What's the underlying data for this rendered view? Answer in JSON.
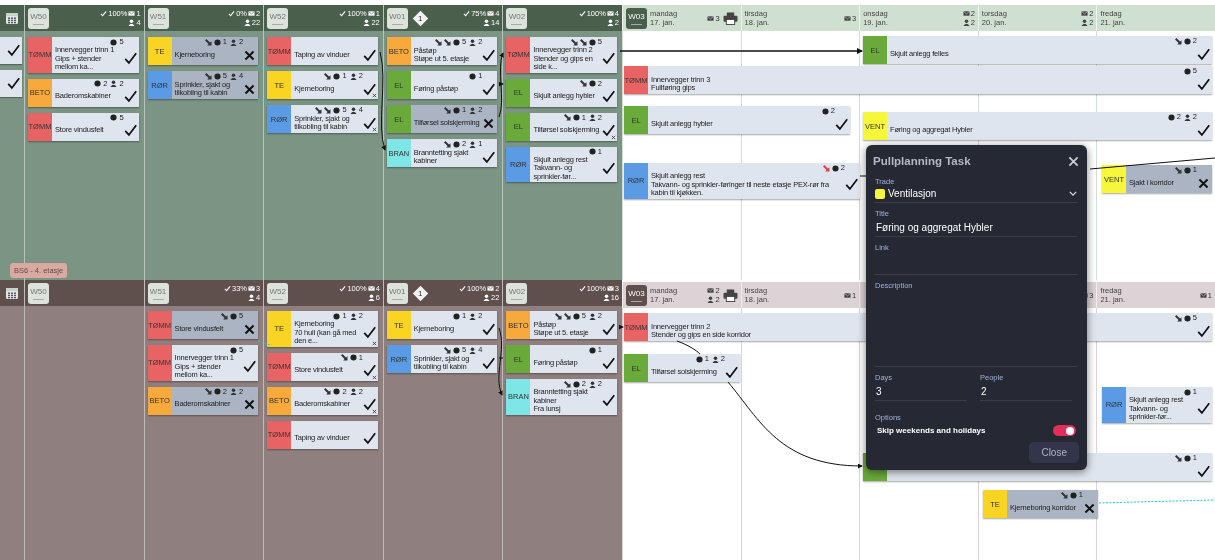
{
  "lanes": [
    {
      "label": "BS6 - 4. etasje",
      "cut_tasks": [
        {
          "blocked": false
        },
        {
          "blocked": false
        }
      ],
      "weeks": [
        {
          "week": "W50",
          "done": "100%",
          "messages": "1",
          "people": "4",
          "tasks": [
            {
              "trade": "TØMM",
              "color": "#e86464",
              "title": "Innervegger trinn 1",
              "subtitle": "Gips + stender mellom ka...",
              "comments": "5",
              "blocked": false,
              "flagged": false
            },
            {
              "trade": "BETO",
              "color": "#f7a93b",
              "title": "Baderomskabiner",
              "comments": "2",
              "people": "2",
              "blocked": false,
              "flagged": false
            },
            {
              "trade": "TØMM",
              "color": "#e86464",
              "title": "Store vindusfelt",
              "comments": "5",
              "blocked": false,
              "flagged": false
            }
          ]
        },
        {
          "week": "W51",
          "done": "0%",
          "messages": "2",
          "people": "22",
          "tasks": [
            {
              "trade": "TE",
              "color": "#f9d423",
              "title": "Kjerneboring",
              "links": [
                {
                  "color": "#333333"
                }
              ],
              "comments": "1",
              "people": "2",
              "blocked": true,
              "flagged": false
            },
            {
              "trade": "RØR",
              "color": "#5b9be6",
              "title": "Sprinkler, sjakt og tilkobling til kabin",
              "links": [
                {
                  "color": "#333333"
                }
              ],
              "comments": "5",
              "people": "4",
              "blocked": true,
              "flagged": false
            }
          ]
        },
        {
          "week": "W52",
          "done": "100%",
          "messages": "1",
          "people": "22",
          "tasks": [
            {
              "trade": "TØMM",
              "color": "#e86464",
              "title": "Taping av vinduer",
              "blocked": false,
              "flagged": false
            },
            {
              "trade": "TE",
              "color": "#f9d423",
              "title": "Kjerneboring",
              "links": [
                {
                  "color": "#333333"
                }
              ],
              "comments": "1",
              "people": "2",
              "blocked": false,
              "flagged": true
            },
            {
              "trade": "RØR",
              "color": "#5b9be6",
              "title": "Sprinkler, sjakt og tilkobling til kabin",
              "links": [
                {
                  "color": "#333333"
                },
                {
                  "color": "#333333"
                }
              ],
              "comments": "5",
              "people": "4",
              "blocked": false,
              "flagged": true
            }
          ]
        },
        {
          "week": "W01",
          "milestone": "1",
          "done": "75%",
          "messages": "4",
          "people": "14",
          "tasks": [
            {
              "trade": "BETO",
              "color": "#f7a93b",
              "title": "Påstøp",
              "subtitle": "Støpe ut 5. etasje",
              "links": [
                {
                  "color": "#333333"
                },
                {
                  "color": "#333333"
                }
              ],
              "comments": "5",
              "people": "2",
              "blocked": false,
              "flagged": false
            },
            {
              "trade": "EL",
              "color": "#6aaa3a",
              "title": "Føring påstøp",
              "comments": "1",
              "blocked": false,
              "flagged": false
            },
            {
              "trade": "EL",
              "color": "#6aaa3a",
              "title": "Tilførsel solskjerming",
              "links": [
                {
                  "color": "#333333"
                }
              ],
              "comments": "1",
              "people": "2",
              "blocked": true,
              "flagged": false
            },
            {
              "trade": "BRAN",
              "color": "#7ee6e6",
              "title": "Branntetting sjakt kabiner",
              "links": [
                {
                  "color": "#333333"
                }
              ],
              "comments": "2",
              "people": "1",
              "blocked": false,
              "flagged": false
            }
          ]
        },
        {
          "week": "W02",
          "done": "100%",
          "messages": "4",
          "people": "2",
          "tasks": [
            {
              "trade": "TØMM",
              "color": "#e86464",
              "title": "Innervegger trinn 2",
              "subtitle": "Stender og gips en side k...",
              "links": [
                {
                  "color": "#333333"
                },
                {
                  "color": "#333333"
                }
              ],
              "comments": "5",
              "blocked": false,
              "flagged": false
            },
            {
              "trade": "EL",
              "color": "#6aaa3a",
              "title": "Skjult anlegg hybler",
              "links": [
                {
                  "color": "#333333"
                }
              ],
              "comments": "2",
              "blocked": false,
              "flagged": false
            },
            {
              "trade": "EL",
              "color": "#6aaa3a",
              "title": "Tilførsel solskjerming",
              "links": [
                {
                  "color": "#333333"
                }
              ],
              "comments": "1",
              "people": "2",
              "blocked": false,
              "flagged": true
            },
            {
              "trade": "RØR",
              "color": "#5b9be6",
              "title": "Skjult anlegg rest",
              "subtitle": "Takvann- og sprinkler-før...",
              "comments": "1",
              "blocked": false,
              "flagged": false
            }
          ]
        }
      ],
      "day_week": "W03",
      "days": [
        {
          "day": "mandag",
          "date": "17. jan.",
          "messages": "3"
        },
        {
          "day": "tirsdag",
          "date": "18. jan.",
          "messages": "3"
        },
        {
          "day": "onsdag",
          "date": "19. jan.",
          "messages": "2",
          "people": "2"
        },
        {
          "day": "torsdag",
          "date": "20. jan.",
          "messages": "2",
          "people": "2"
        },
        {
          "day": "fredag",
          "date": "21. jan."
        }
      ],
      "timeline": [
        {
          "trade": "EL",
          "color": "#6aaa3a",
          "title": "Skjult anlegg felles",
          "links": [
            {
              "color": "#333333"
            }
          ],
          "comments": "2",
          "blocked": false,
          "flagged": false
        },
        {
          "trade": "TØMM",
          "color": "#e86464",
          "title": "Innervegger trinn 3",
          "subtitle": "Fullføring gips",
          "comments": "5",
          "blocked": false,
          "flagged": false
        },
        {
          "trade": "EL",
          "color": "#6aaa3a",
          "title": "Skjult anlegg hybler",
          "comments": "2",
          "blocked": false,
          "flagged": false
        },
        {
          "trade": "VENT",
          "color": "#f6f63a",
          "title": "Føring og aggregat Hybler",
          "comments": "2",
          "people": "2",
          "blocked": false,
          "flagged": false
        },
        {
          "trade": "RØR",
          "color": "#5b9be6",
          "title": "Skjult anlegg rest",
          "subtitle": "Takvann- og sprinkler-føringer til neste etasje PEX-rør fra kabin til kjøkken.",
          "links": [
            {
              "color": "#e04040"
            }
          ],
          "comments": "2",
          "blocked": false,
          "flagged": false
        },
        {
          "trade": "VENT",
          "color": "#f6f63a",
          "title": "Sjakt i korridor",
          "links": [
            {
              "color": "#333333"
            }
          ],
          "comments": "1",
          "blocked": true,
          "flagged": false
        }
      ]
    },
    {
      "weeks": [
        {
          "week": "W50"
        },
        {
          "week": "W51",
          "done": "33%",
          "messages": "3",
          "people": "4",
          "tasks": [
            {
              "trade": "TØMM",
              "color": "#e86464",
              "title": "Store vindusfelt",
              "links": [
                {
                  "color": "#333333"
                }
              ],
              "comments": "5",
              "blocked": true,
              "flagged": false
            },
            {
              "trade": "TØMM",
              "color": "#e86464",
              "title": "Innervegger trinn 1",
              "subtitle": "Gips + stender mellom ka...",
              "comments": "5",
              "blocked": false,
              "flagged": false
            },
            {
              "trade": "BETO",
              "color": "#f7a93b",
              "title": "Baderomskabiner",
              "links": [
                {
                  "color": "#333333"
                }
              ],
              "comments": "2",
              "people": "2",
              "blocked": true,
              "flagged": false
            }
          ]
        },
        {
          "week": "W52",
          "done": "100%",
          "messages": "4",
          "people": "6",
          "tasks": [
            {
              "trade": "TE",
              "color": "#f9d423",
              "title": "Kjerneboring",
              "subtitle": "70 hull (kan gå med den e...",
              "comments": "1",
              "people": "2",
              "blocked": false,
              "flagged": true
            },
            {
              "trade": "TØMM",
              "color": "#e86464",
              "title": "Store vindusfelt",
              "links": [
                {
                  "color": "#333333"
                }
              ],
              "comments": "1",
              "blocked": false,
              "flagged": true
            },
            {
              "trade": "BETO",
              "color": "#f7a93b",
              "title": "Baderomskabiner",
              "links": [
                {
                  "color": "#333333"
                }
              ],
              "comments": "2",
              "people": "2",
              "blocked": false,
              "flagged": true
            },
            {
              "trade": "TØMM",
              "color": "#e86464",
              "title": "Taping av vinduer",
              "blocked": false,
              "flagged": false
            }
          ]
        },
        {
          "week": "W01",
          "milestone": "1",
          "done": "100%",
          "messages": "2",
          "people": "22",
          "tasks": [
            {
              "trade": "TE",
              "color": "#f9d423",
              "title": "Kjerneboring",
              "comments": "1",
              "people": "2",
              "blocked": false,
              "flagged": false
            },
            {
              "trade": "RØR",
              "color": "#5b9be6",
              "title": "Sprinkler, sjakt og tilkobling til kabin",
              "links": [
                {
                  "color": "#333333"
                }
              ],
              "comments": "5",
              "people": "4",
              "blocked": false,
              "flagged": false
            }
          ]
        },
        {
          "week": "W02",
          "done": "100%",
          "messages": "3",
          "people": "16",
          "tasks": [
            {
              "trade": "BETO",
              "color": "#f7a93b",
              "title": "Påstøp",
              "subtitle": "Støpe ut 5. etasje",
              "links": [
                {
                  "color": "#333333"
                },
                {
                  "color": "#333333"
                }
              ],
              "comments": "5",
              "people": "2",
              "blocked": false,
              "flagged": false
            },
            {
              "trade": "EL",
              "color": "#6aaa3a",
              "title": "Føring påstøp",
              "comments": "1",
              "blocked": false,
              "flagged": false
            },
            {
              "trade": "BRAN",
              "color": "#7ee6e6",
              "title": "Branntetting sjakt kabiner",
              "subtitle": "Fra lunsj",
              "links": [
                {
                  "color": "#333333"
                }
              ],
              "comments": "2",
              "people": "2",
              "blocked": false,
              "flagged": false
            }
          ]
        }
      ],
      "day_week": "W03",
      "days": [
        {
          "day": "mandag",
          "date": "17. jan.",
          "messages": "2",
          "people": "2"
        },
        {
          "day": "tirsdag",
          "date": "18. jan.",
          "messages": "1"
        },
        {
          "messages": "3",
          "after_gap": true
        },
        {
          "day": "fredag",
          "date": "21. jan.",
          "messages": "1"
        }
      ],
      "timeline": [
        {
          "trade": "TØMM",
          "color": "#e86464",
          "title": "Innervegger trinn 2",
          "subtitle": "Stender og gips en side korridor",
          "links": [
            {
              "color": "#333333"
            }
          ],
          "comments": "5",
          "blocked": false,
          "flagged": false
        },
        {
          "trade": "EL",
          "color": "#6aaa3a",
          "title": "Tilførsel solskjerming",
          "comments": "1",
          "people": "2",
          "blocked": false,
          "flagged": false
        },
        {
          "trade": "RØR",
          "color": "#5b9be6",
          "title": "Skjult anlegg rest",
          "subtitle": "Takvann- og sprinkler-før...",
          "comments": "1",
          "blocked": false,
          "flagged": false
        },
        {
          "color": "#6aaa3a",
          "links": [
            {
              "color": "#333333"
            }
          ],
          "comments": "1",
          "blocked": false,
          "flagged": false
        },
        {
          "trade": "TE",
          "color": "#f9d423",
          "title": "Kjerneboring korridor",
          "links": [
            {
              "color": "#333333"
            }
          ],
          "comments": "1",
          "blocked": true,
          "flagged": false
        }
      ]
    }
  ],
  "dialog": {
    "title": "Pullplanning Task",
    "trade": {
      "label": "Trade",
      "value": "Ventilasjon",
      "color": "#f6f63a"
    },
    "title_field": {
      "label": "Title",
      "value": "Føring og aggregat Hybler"
    },
    "link": {
      "label": "Link"
    },
    "description": {
      "label": "Description"
    },
    "days": {
      "label": "Days",
      "value": "3"
    },
    "people": {
      "label": "People",
      "value": "2"
    },
    "options": {
      "label": "Options",
      "toggle_label": "Skip weekends and holidays",
      "on": true
    },
    "close": "Close"
  }
}
